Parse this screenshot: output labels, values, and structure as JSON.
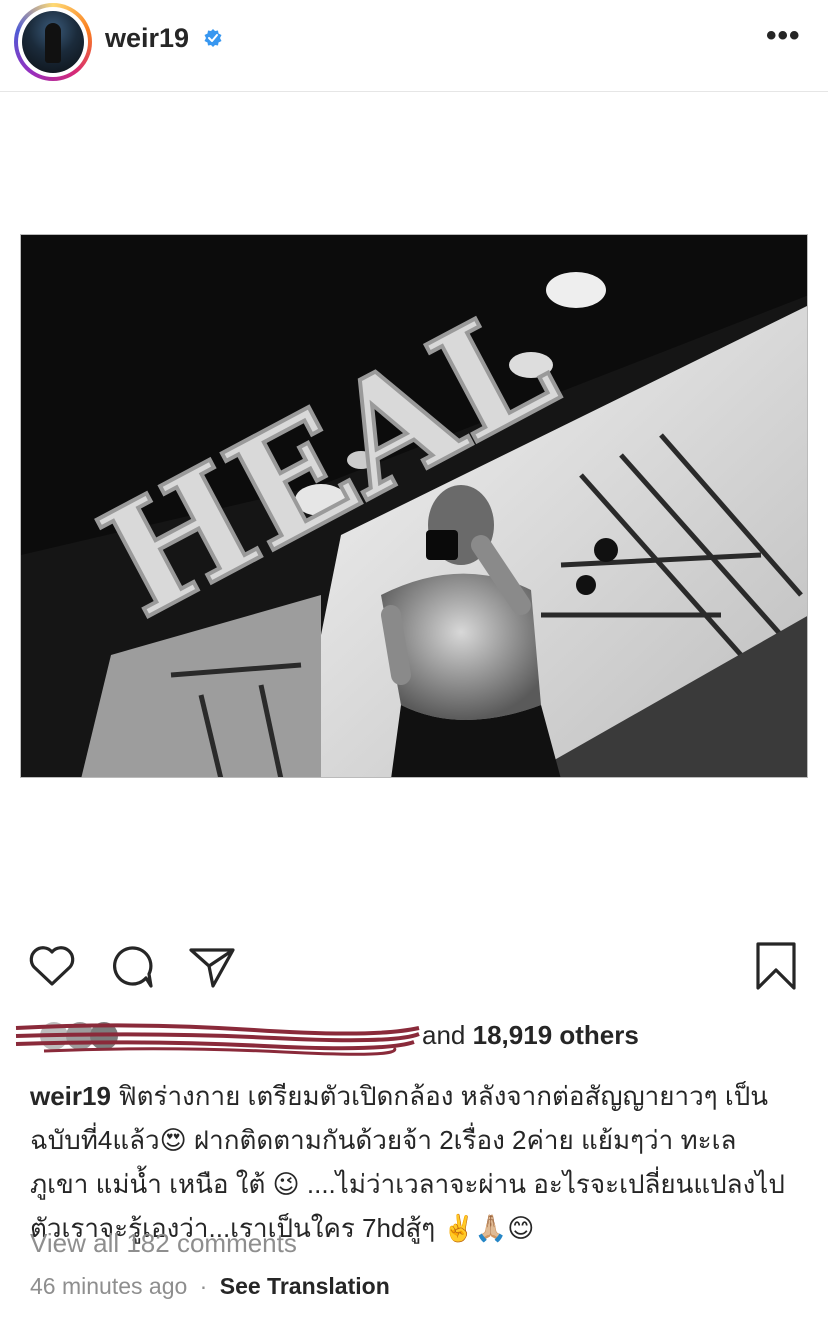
{
  "post": {
    "username": "weir19",
    "more_label": "•••"
  },
  "photo": {
    "sign_text": "HEAL"
  },
  "likes": {
    "and_label": "and",
    "count_label": "18,919 others"
  },
  "caption": {
    "username": "weir19",
    "text": "ฟิตร่างกาย เตรียมตัวเปิดกล้อง หลังจากต่อสัญญายาวๆ เป็นฉบับที่4แล้ว😍 ฝากติดตามกันด้วยจ้า 2เรื่อง 2ค่าย แย้มๆว่า ทะเล ภูเขา แม่น้ำ เหนือ ใต้ 😉 ....ไม่ว่าเวลาจะผ่าน อะไรจะเปลี่ยนแปลงไป ตัวเราจะรู้เองว่า...เราเป็นใคร 7hdสู้ๆ ✌️🙏🏼😊"
  },
  "comments": {
    "view_all_label": "View all 182 comments"
  },
  "meta": {
    "time_label": "46 minutes ago",
    "separator": "·",
    "see_translation_label": "See Translation"
  },
  "colors": {
    "verified": "#3897f0",
    "text": "#262626",
    "muted": "#8e8e8e",
    "scribble": "#8a2a3a"
  }
}
